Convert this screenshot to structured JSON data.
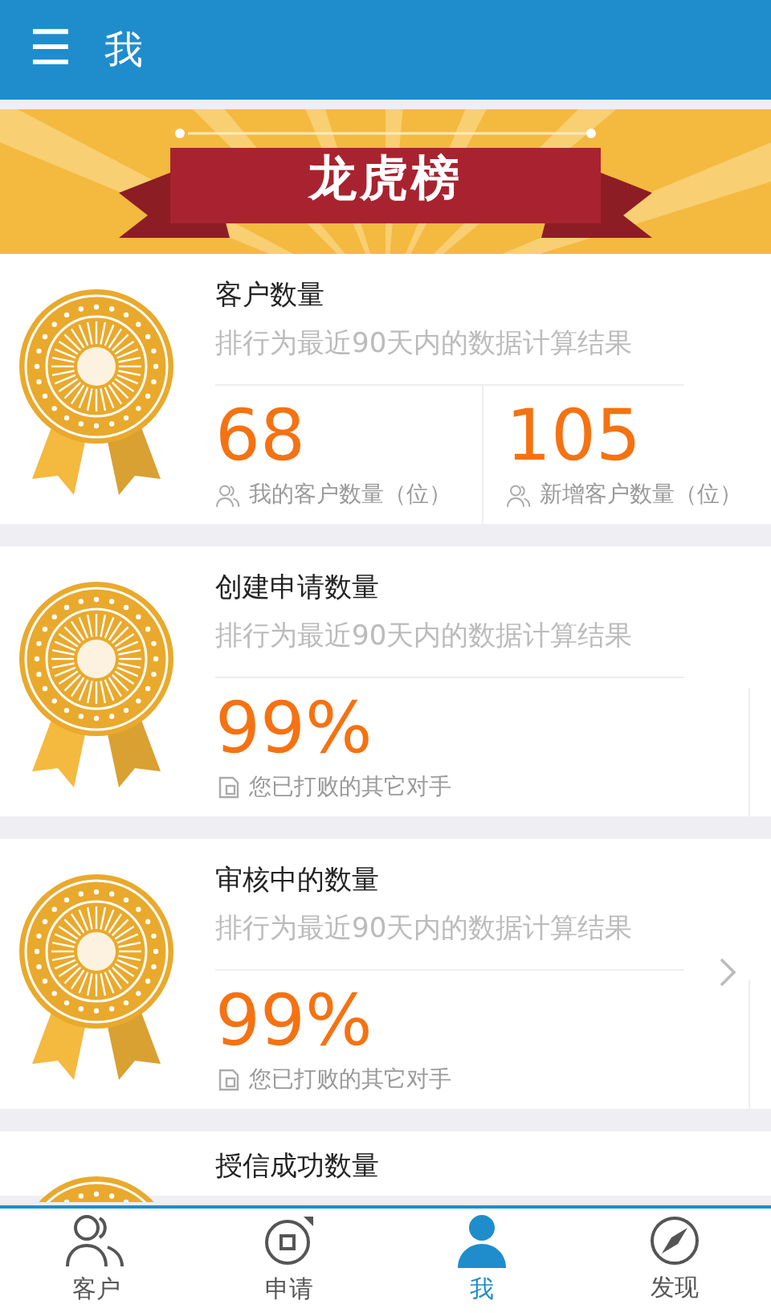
{
  "header": {
    "menu_icon": "☰",
    "title": "我"
  },
  "banner": {
    "title": "龙虎榜"
  },
  "cards": [
    {
      "kind": "pair",
      "title": "客户数量",
      "subtitle": "排行为最近90天内的数据计算结果",
      "arrow": false,
      "stats": [
        {
          "value": "68",
          "label": "我的客户数量（位）"
        },
        {
          "value": "105",
          "label": "新增客户数量（位）"
        }
      ]
    },
    {
      "kind": "percent",
      "title": "创建申请数量",
      "subtitle": "排行为最近90天内的数据计算结果",
      "arrow": false,
      "value": "99%",
      "note": "您已打败的其它对手"
    },
    {
      "kind": "percent",
      "title": "审核中的数量",
      "subtitle": "排行为最近90天内的数据计算结果",
      "arrow": true,
      "value": "99%",
      "note": "您已打败的其它对手"
    },
    {
      "kind": "cut",
      "title": "授信成功数量"
    }
  ],
  "nav": [
    {
      "label": "客户",
      "kind": "people",
      "selected": false
    },
    {
      "label": "申请",
      "kind": "apply",
      "selected": false
    },
    {
      "label": "我",
      "kind": "person",
      "selected": true
    },
    {
      "label": "发现",
      "kind": "compass",
      "selected": false
    }
  ]
}
